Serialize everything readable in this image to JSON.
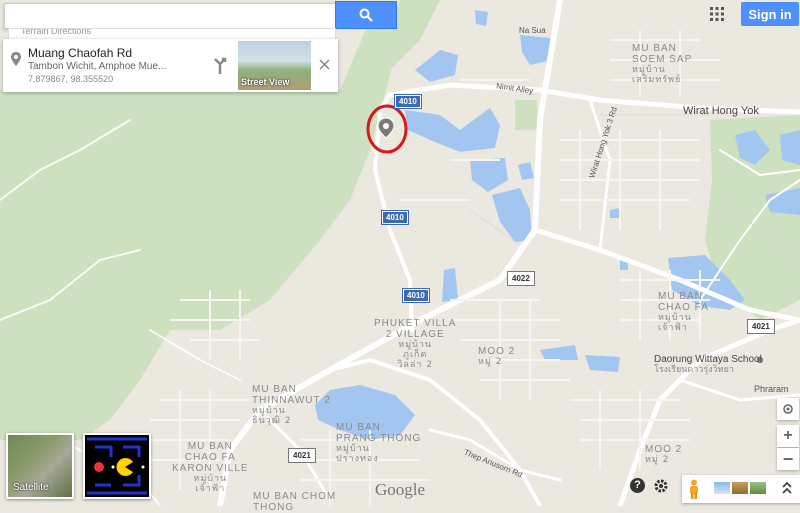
{
  "search": {
    "value": "",
    "placeholder": "",
    "sub_tab": "Terrain   Directions"
  },
  "card": {
    "title": "Muang Chaofah Rd",
    "address": "Tambon Wichit, Amphoe Mue...",
    "coords": "7.879867, 98.355520",
    "street_view_label": "Street View"
  },
  "header": {
    "sign_in": "Sign in"
  },
  "roads": {
    "route_4010_a": "4010",
    "route_4010_b": "4010",
    "route_4010_c": "4010",
    "route_4022": "4022",
    "route_4021_a": "4021",
    "route_4021_b": "4021",
    "wirat_hong_yok": "Wirat Hong Yok",
    "nimit_alley": "Nimit Alley",
    "na_sua": "Na Sua",
    "wirat_hong_yok_3": "Wirat Hong Yok 3 Rd",
    "thep_anusorn": "Thep Anusorn Rd",
    "phraram": "Phraram"
  },
  "places": {
    "mu_ban_soem_sap": [
      "MU BAN",
      "SOEM SAP",
      "หมู่บ้าน",
      "เสริมทรัพย์"
    ],
    "phuket_villa": [
      "PHUKET VILLA",
      "2 VILLAGE",
      "หมู่บ้าน",
      "ภูเก็ต",
      "วิลล่า 2"
    ],
    "moo2_a": [
      "MOO 2",
      "หมู่ 2"
    ],
    "mu_ban_chao_fa": [
      "MU BAN",
      "CHAO FA",
      "หมู่บ้าน",
      "เจ้าฟ้า"
    ],
    "daorung": [
      "Daorung Wittaya School",
      "โรงเรียนดาวรุ่งวิทยา"
    ],
    "thinnawut": [
      "MU BAN",
      "THINNAWUT 2",
      "หมู่บ้าน",
      "ธินวุฒิ 2"
    ],
    "prang_thong": [
      "MU BAN",
      "PRANG THONG",
      "หมู่บ้าน",
      "ปรางทอง"
    ],
    "chao_fa_karon": [
      "MU BAN",
      "CHAO FA",
      "KARON VILLE",
      "หมู่บ้าน",
      "เจ้าฟ้า"
    ],
    "chom_thong": [
      "MU BAN CHOM",
      "THONG"
    ],
    "moo2_b": [
      "MOO 2",
      "หมู่ 2"
    ]
  },
  "layers": {
    "satellite_label": "Satellite"
  },
  "footer": {
    "google": "Google"
  },
  "colors": {
    "land": "#ebe8e0",
    "park": "#cde0c0",
    "water": "#a3c6f0",
    "road": "#ffffff",
    "shield": "#3b6ab5",
    "accent": "#4d90fe",
    "marker_circle": "#d8181c"
  }
}
